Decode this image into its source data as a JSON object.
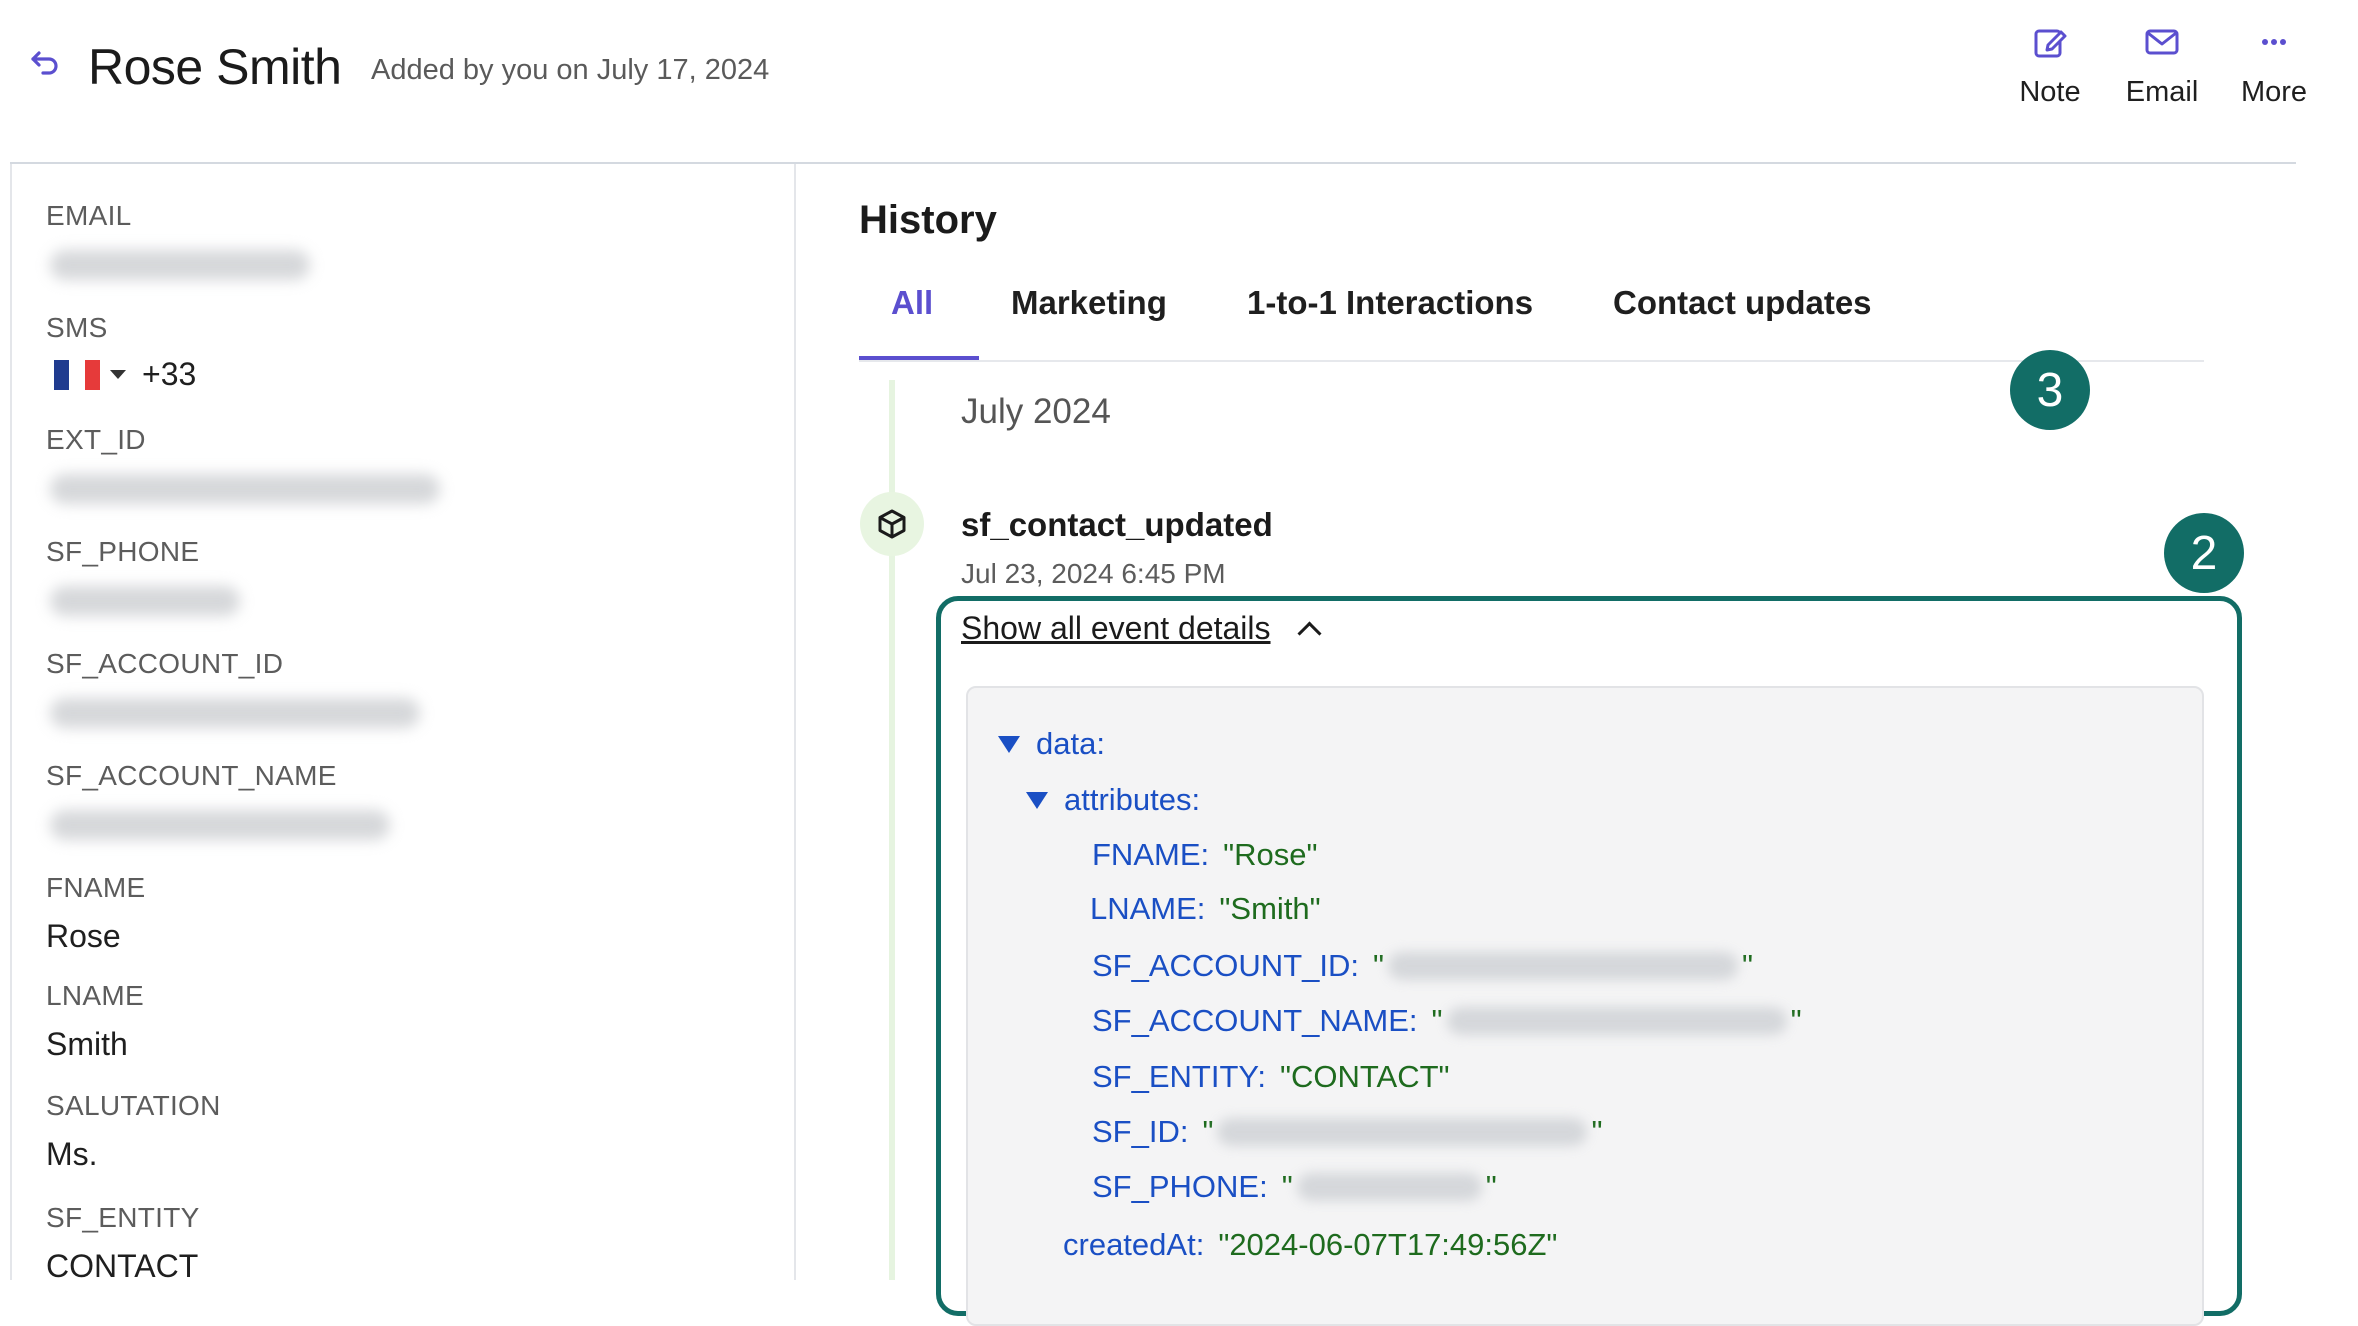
{
  "header": {
    "contact_name": "Rose Smith",
    "added_by": "Added by you on July 17, 2024",
    "actions": [
      {
        "label": "Note",
        "icon": "edit-icon"
      },
      {
        "label": "Email",
        "icon": "mail-icon"
      },
      {
        "label": "More",
        "icon": "more-dots-icon"
      }
    ]
  },
  "attributes": {
    "email": {
      "label": "EMAIL"
    },
    "sms": {
      "label": "SMS",
      "country_code": "+33",
      "flag": "france-flag-icon"
    },
    "ext_id": {
      "label": "EXT_ID"
    },
    "sf_phone": {
      "label": "SF_PHONE"
    },
    "sf_account_id": {
      "label": "SF_ACCOUNT_ID"
    },
    "sf_account_name": {
      "label": "SF_ACCOUNT_NAME"
    },
    "fname": {
      "label": "FNAME",
      "value": "Rose"
    },
    "lname": {
      "label": "LNAME",
      "value": "Smith"
    },
    "salutation": {
      "label": "SALUTATION",
      "value": "Ms."
    },
    "sf_entity": {
      "label": "SF_ENTITY",
      "value": "CONTACT"
    }
  },
  "history": {
    "title": "History",
    "tabs": [
      "All",
      "Marketing",
      "1-to-1 Interactions",
      "Contact updates"
    ],
    "active_tab": "All",
    "month": "July 2024",
    "event": {
      "name": "sf_contact_updated",
      "time": "Jul 23, 2024 6:45 PM",
      "show_details": "Show all event details",
      "details": {
        "data_key": "data:",
        "attributes_key": "attributes:",
        "fname_key": "FNAME:",
        "fname_value": "\"Rose\"",
        "lname_key": "LNAME:",
        "lname_value": "\"Smith\"",
        "sf_account_id_key": "SF_ACCOUNT_ID:",
        "sf_account_name_key": "SF_ACCOUNT_NAME:",
        "sf_entity_key": "SF_ENTITY:",
        "sf_entity_value": "\"CONTACT\"",
        "sf_id_key": "SF_ID:",
        "sf_phone_key": "SF_PHONE:",
        "created_at_key": "createdAt:",
        "created_at_value": "\"2024-06-07T17:49:56Z\""
      }
    }
  },
  "callouts": {
    "first": "3",
    "second": "2"
  },
  "colors": {
    "accent": "#5b4fcf",
    "callout": "#126d66",
    "json_key": "#1a4fc4",
    "json_value": "#1e6b1e"
  }
}
